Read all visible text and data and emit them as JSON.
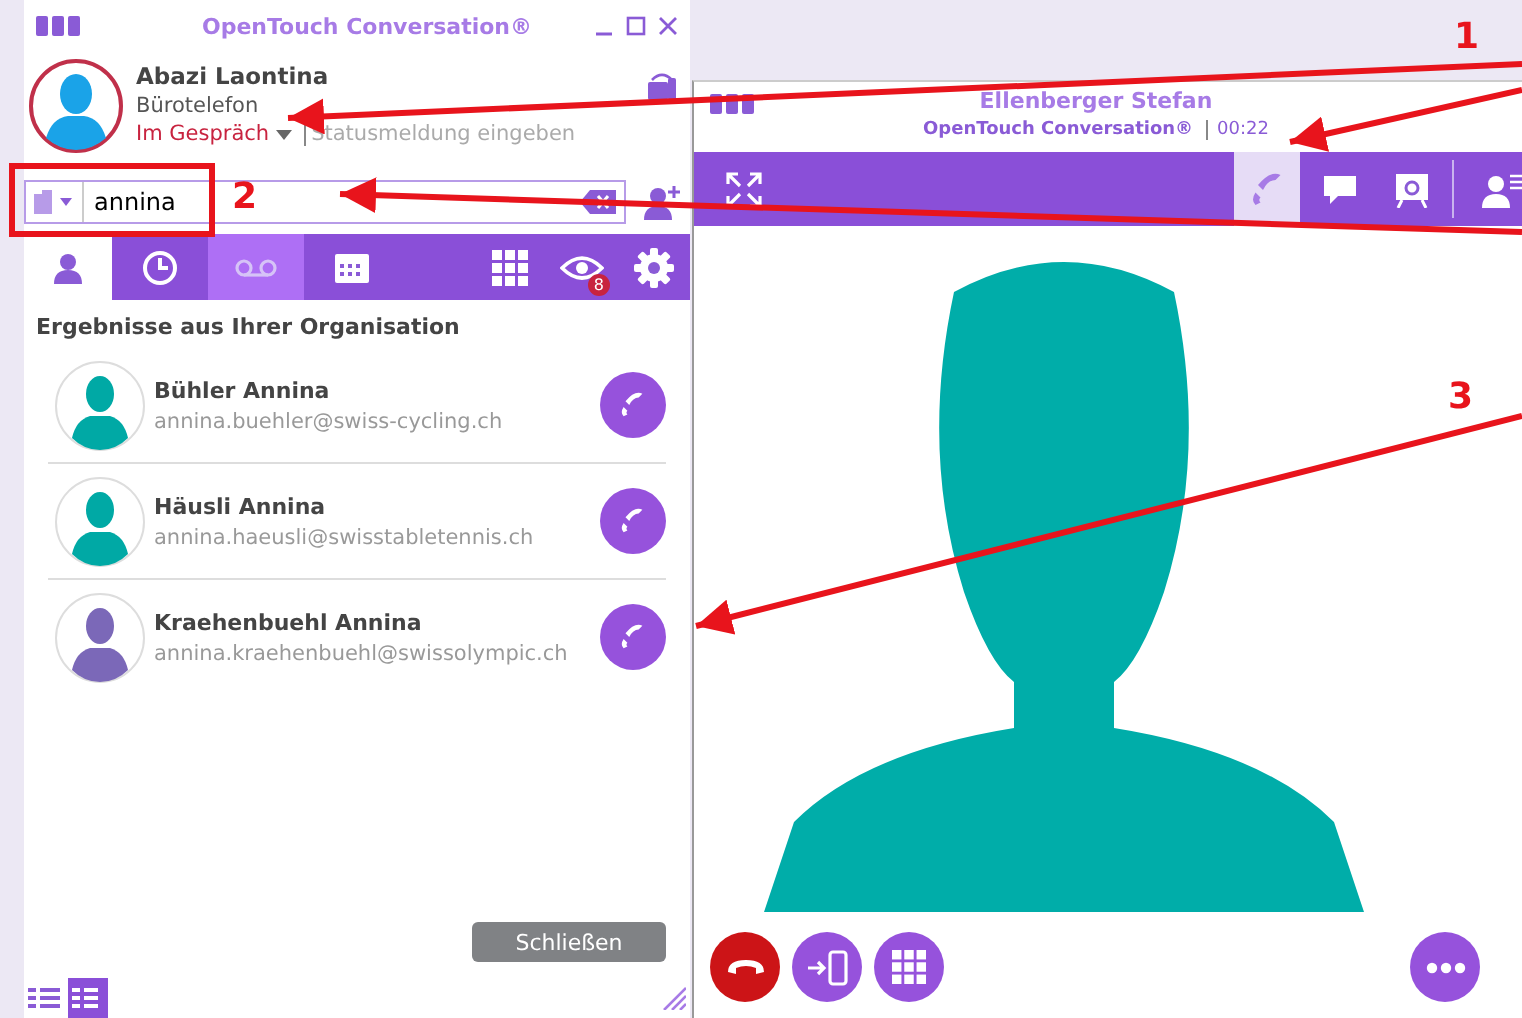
{
  "main_window": {
    "title": "OpenTouch Conversation®",
    "profile": {
      "name": "Abazi Laontina",
      "device": "Bürotelefon",
      "presence": "Im Gespräch",
      "status_placeholder": "Statusmeldung eingeben"
    },
    "search": {
      "value": "annina"
    },
    "tabs": [
      {
        "kind": "contacts",
        "selected": true
      },
      {
        "kind": "history",
        "selected": false
      },
      {
        "kind": "voicemail",
        "selected": false
      },
      {
        "kind": "calendar",
        "selected": false
      }
    ],
    "tools": [
      {
        "kind": "dialpad"
      },
      {
        "kind": "watch",
        "badge": "8"
      },
      {
        "kind": "settings"
      }
    ],
    "results_heading": "Ergebnisse aus Ihrer Organisation",
    "results": [
      {
        "name": "Bühler Annina",
        "email": "annina.buehler@swiss-cycling.ch",
        "color": "#00a9a5"
      },
      {
        "name": "Häusli Annina",
        "email": "annina.haeusli@swisstabletennis.ch",
        "color": "#00a9a5"
      },
      {
        "name": "Kraehenbuehl Annina",
        "email": "annina.kraehenbuehl@swissolympic.ch",
        "color": "#7b68b8"
      }
    ],
    "close_button": "Schließen",
    "views": [
      {
        "kind": "list",
        "selected": false
      },
      {
        "kind": "detail",
        "selected": true
      }
    ]
  },
  "call_window": {
    "title": "Ellenberger Stefan",
    "app": "OpenTouch Conversation®",
    "duration": "00:22",
    "toolbar": [
      {
        "kind": "phone",
        "selected": true
      },
      {
        "kind": "chat",
        "selected": false
      },
      {
        "kind": "share",
        "selected": false
      },
      {
        "kind": "contact",
        "selected": false
      }
    ],
    "actions": [
      {
        "kind": "hangup"
      },
      {
        "kind": "transfer"
      },
      {
        "kind": "dialpad"
      }
    ]
  },
  "annotations": [
    {
      "label": "1"
    },
    {
      "label": "2"
    },
    {
      "label": "3"
    }
  ]
}
